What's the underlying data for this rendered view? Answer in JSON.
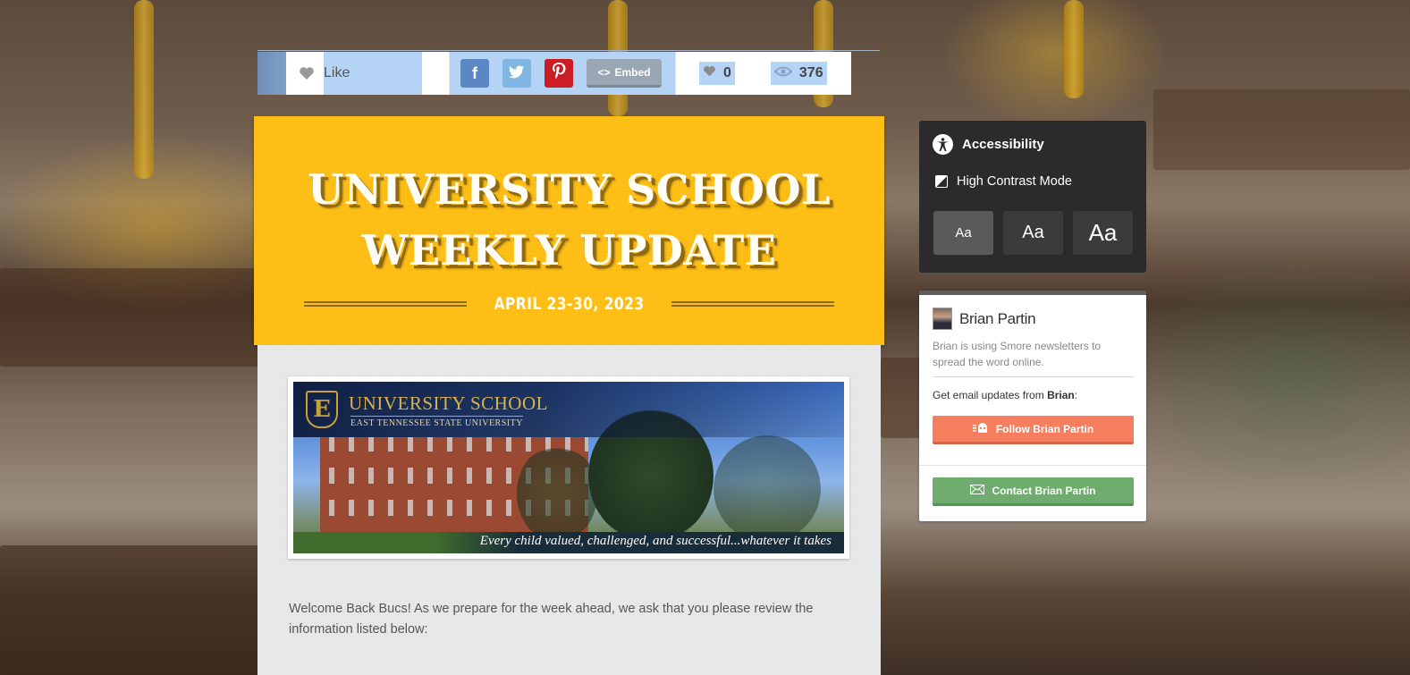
{
  "sharebar": {
    "like_label": "Like",
    "social_icons": [
      "facebook-icon",
      "twitter-icon",
      "pinterest-icon"
    ],
    "embed_label": "Embed",
    "likes_count": "0",
    "views_count": "376"
  },
  "header": {
    "title_line1": "UNIVERSITY SCHOOL",
    "title_line2": "WEEKLY UPDATE",
    "date": "APRIL 23-30, 2023",
    "background_color": "#fdbd12"
  },
  "banner": {
    "school_name": "UNIVERSITY SCHOOL",
    "school_subtitle": "EAST TENNESSEE STATE UNIVERSITY",
    "logo_letter": "E",
    "tagline": "Every child valued, challenged, and successful...whatever it takes"
  },
  "body": {
    "welcome_text": "Welcome Back Bucs! As we prepare for the week ahead, we ask that you please review the information listed below:"
  },
  "accessibility": {
    "title": "Accessibility",
    "contrast_label": "High Contrast Mode",
    "size_options": [
      "Aa",
      "Aa",
      "Aa"
    ]
  },
  "author": {
    "name": "Brian Partin",
    "description": "Brian is using Smore newsletters to spread the word online.",
    "updates_prefix": "Get email updates from ",
    "updates_name": "Brian",
    "updates_suffix": ":",
    "follow_label": "Follow Brian Partin",
    "contact_label": "Contact Brian Partin",
    "follow_color": "#f47e5e",
    "contact_color": "#6fad6f"
  }
}
